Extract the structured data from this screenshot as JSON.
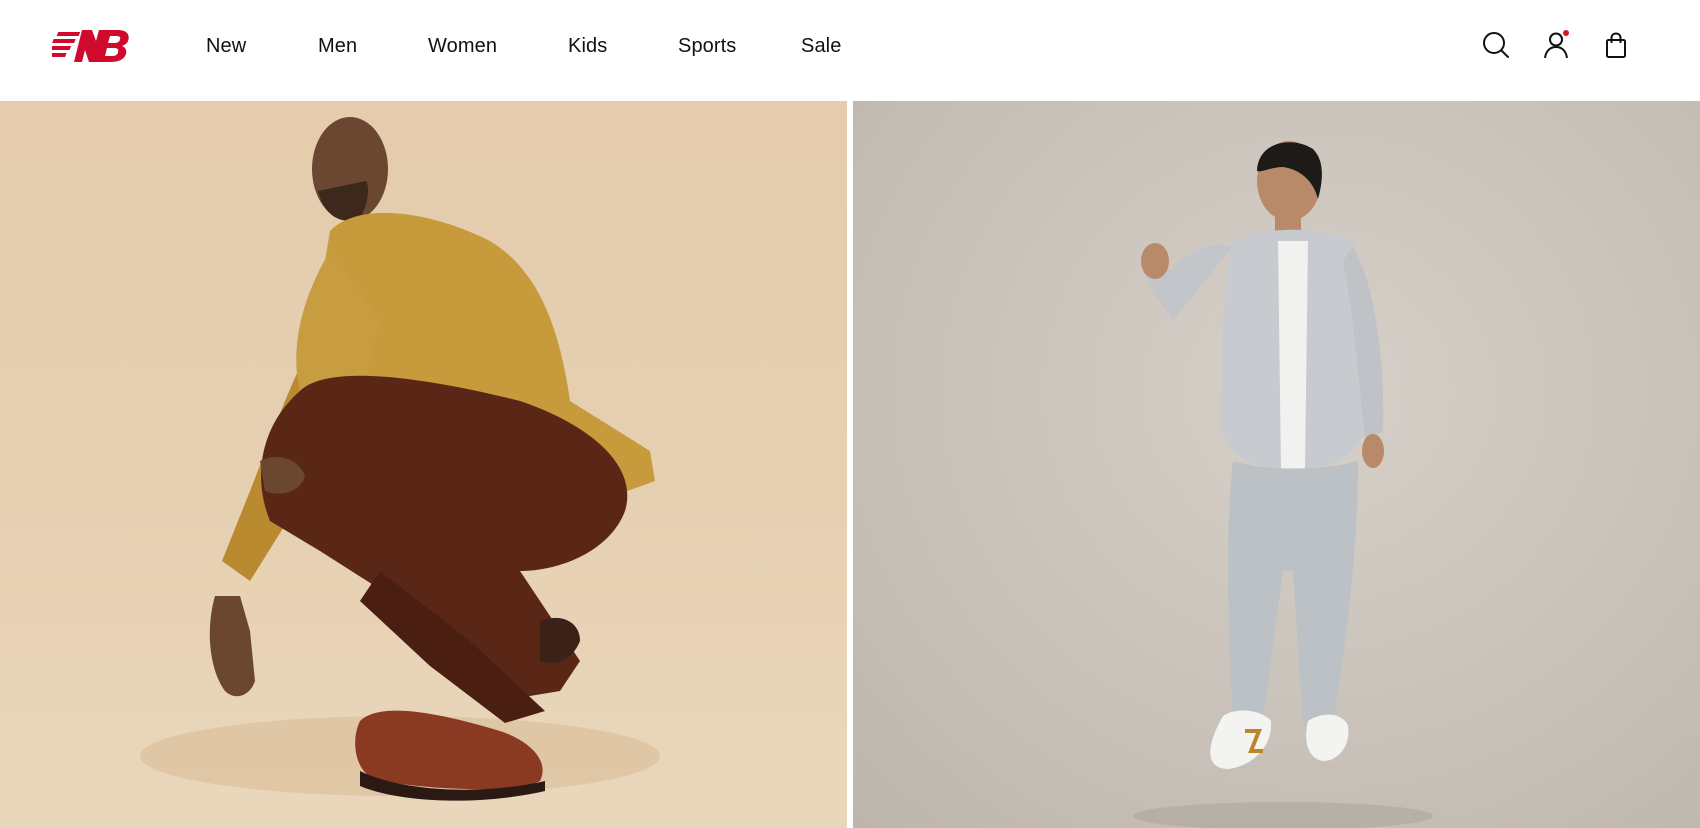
{
  "brand": {
    "logo_icon": "new-balance-logo-icon",
    "color": "#cf0a2c"
  },
  "nav": {
    "items": [
      {
        "label": "New"
      },
      {
        "label": "Men"
      },
      {
        "label": "Women"
      },
      {
        "label": "Kids"
      },
      {
        "label": "Sports"
      },
      {
        "label": "Sale"
      }
    ]
  },
  "header_icons": {
    "search": "search-icon",
    "account": "account-icon",
    "cart": "shopping-bag-icon",
    "notification_color": "#e0161e"
  },
  "hero": {
    "left_image": "man-crouching-mustard-sweatshirt-brown-pants-photo",
    "right_image": "man-standing-grey-tracksuit-photo"
  }
}
